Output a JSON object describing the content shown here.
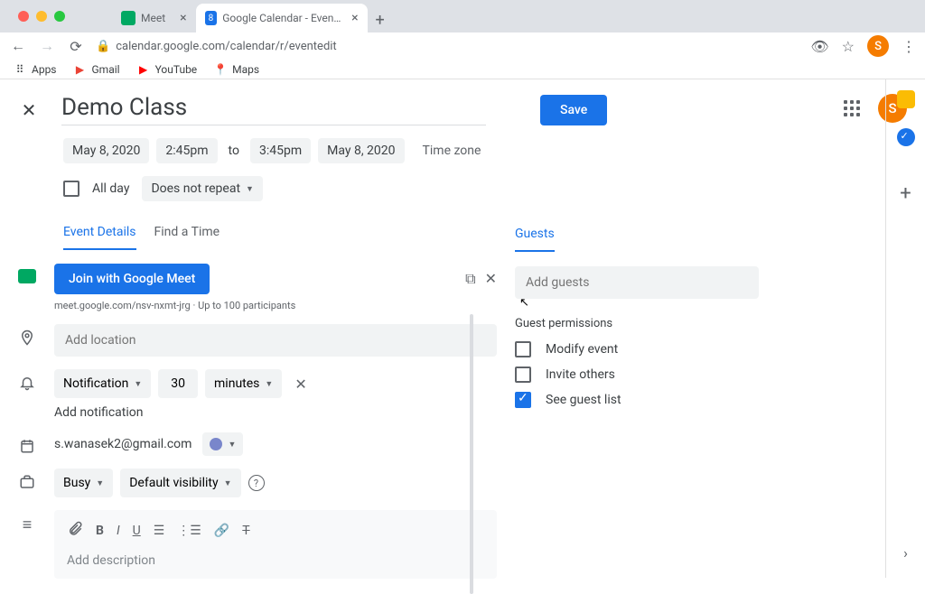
{
  "browser": {
    "tabs": [
      {
        "title": "Meet",
        "icon_color": "#00a862"
      },
      {
        "title": "Google Calendar - Event detai",
        "icon_label": "8",
        "icon_bg": "#1a73e8"
      }
    ],
    "url": "calendar.google.com/calendar/r/eventedit",
    "bookmarks": [
      "Apps",
      "Gmail",
      "YouTube",
      "Maps"
    ],
    "avatar_letter": "S"
  },
  "event": {
    "title": "Demo Class",
    "save_label": "Save",
    "date_start": "May 8, 2020",
    "time_start": "2:45pm",
    "to_label": "to",
    "time_end": "3:45pm",
    "date_end": "May 8, 2020",
    "timezone_label": "Time zone",
    "allday_label": "All day",
    "repeat_label": "Does not repeat"
  },
  "tabs": {
    "details": "Event Details",
    "find_time": "Find a Time"
  },
  "meet": {
    "join_label": "Join with Google Meet",
    "link": "meet.google.com/nsv-nxmt-jrg",
    "sep": " · ",
    "participants": "Up to 100 participants"
  },
  "location": {
    "placeholder": "Add location"
  },
  "notification": {
    "type": "Notification",
    "value": "30",
    "unit": "minutes",
    "add_label": "Add notification"
  },
  "calendar": {
    "email": "s.wanasek2@gmail.com"
  },
  "visibility": {
    "busy": "Busy",
    "default": "Default visibility"
  },
  "description": {
    "placeholder": "Add description"
  },
  "guests": {
    "tab_label": "Guests",
    "add_placeholder": "Add guests",
    "permissions_title": "Guest permissions",
    "modify": "Modify event",
    "invite": "Invite others",
    "see_list": "See guest list"
  }
}
